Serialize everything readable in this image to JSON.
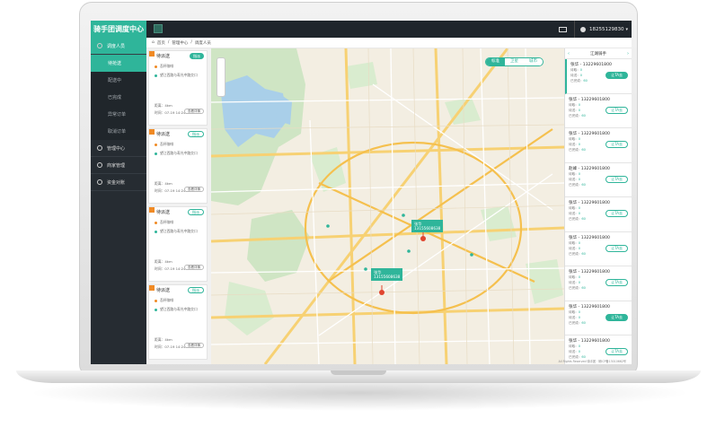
{
  "header": {
    "logo_text": "骑手团调度中心",
    "phone": "18255129830",
    "mail_icon": "mail-icon",
    "user_icon": "user-icon"
  },
  "sidebar": {
    "items": [
      {
        "label": "调度人员",
        "type": "section",
        "active": true
      },
      {
        "label": "待抢送",
        "type": "sub",
        "active": true
      },
      {
        "label": "配送中",
        "type": "sub",
        "active": false
      },
      {
        "label": "已完成",
        "type": "sub",
        "active": false
      },
      {
        "label": "异常订单",
        "type": "sub",
        "active": false
      },
      {
        "label": "取消订单",
        "type": "sub",
        "active": false
      },
      {
        "label": "管理中心",
        "type": "section",
        "active": false
      },
      {
        "label": "商家管理",
        "type": "section",
        "active": false
      },
      {
        "label": "资金对账",
        "type": "section",
        "active": false
      }
    ]
  },
  "breadcrumb": {
    "home": "首页",
    "sep": "/",
    "level1": "管理中心",
    "level2": "调度人员"
  },
  "tasks": [
    {
      "title": "待派送",
      "tag": "指派",
      "tag_style": "filled",
      "shop": "吾杯咖啡",
      "addr": "望江西路与寿光中路交口",
      "distance": "距离：4km",
      "time": "时间：07-19 14:24:46",
      "action": "查看详情"
    },
    {
      "title": "待派送",
      "tag": "指派",
      "tag_style": "outline",
      "shop": "吾杯咖啡",
      "addr": "望江西路与寿光中路交口",
      "distance": "距离：4km",
      "time": "时间：07-19 14:24:46",
      "action": "查看详情"
    },
    {
      "title": "待派送",
      "tag": "指派",
      "tag_style": "outline",
      "shop": "吾杯咖啡",
      "addr": "望江西路与寿光中路交口",
      "distance": "距离：4km",
      "time": "时间：07-19 14:24:46",
      "action": "查看详情"
    },
    {
      "title": "待派送",
      "tag": "指派",
      "tag_style": "outline",
      "shop": "吾杯咖啡",
      "addr": "望江西路与寿光中路交口",
      "distance": "距离：4km",
      "time": "时间：07-19 14:24:46",
      "action": "查看详情"
    }
  ],
  "map": {
    "tabs": [
      "标准",
      "卫星",
      "城市"
    ],
    "active_tab": "标准",
    "riders": [
      {
        "name": "张华",
        "phone": "13155608638"
      },
      {
        "name": "张华",
        "phone": "13155608638"
      }
    ],
    "footer": "All Rights Reserved 骑手团 · 皖ICP备13010662号"
  },
  "right_panel": {
    "title": "江湖骑手",
    "prev": "‹",
    "next": "›",
    "riders": [
      {
        "name": "张华 - 13229601800",
        "s1": "待取：",
        "v1": "0",
        "s2": "待送：",
        "v2": "0",
        "s3": "已完成：",
        "v3": "60",
        "btn": "让TA去",
        "selected": true,
        "btn_on": true
      },
      {
        "name": "张华 - 13229601800",
        "s1": "待取：",
        "v1": "0",
        "s2": "待送：",
        "v2": "0",
        "s3": "已完成：",
        "v3": "60",
        "btn": "让TA去",
        "selected": false,
        "btn_on": false
      },
      {
        "name": "张华 - 13229601800",
        "s1": "待取：",
        "v1": "0",
        "s2": "待送：",
        "v2": "0",
        "s3": "已完成：",
        "v3": "60",
        "btn": "让TA去",
        "selected": false,
        "btn_on": false
      },
      {
        "name": "赵峰 - 13229601800",
        "s1": "待取：",
        "v1": "0",
        "s2": "待送：",
        "v2": "0",
        "s3": "已完成：",
        "v3": "60",
        "btn": "让TA去",
        "selected": false,
        "btn_on": false
      },
      {
        "name": "张华 - 13229601800",
        "s1": "待取：",
        "v1": "0",
        "s2": "待送：",
        "v2": "0",
        "s3": "已完成：",
        "v3": "60",
        "btn": "让TA去",
        "selected": false,
        "btn_on": false
      },
      {
        "name": "张华 - 13229601800",
        "s1": "待取：",
        "v1": "0",
        "s2": "待送：",
        "v2": "0",
        "s3": "已完成：",
        "v3": "60",
        "btn": "让TA去",
        "selected": false,
        "btn_on": false
      },
      {
        "name": "张华 - 13229601800",
        "s1": "待取：",
        "v1": "0",
        "s2": "待送：",
        "v2": "0",
        "s3": "已完成：",
        "v3": "60",
        "btn": "让TA去",
        "selected": false,
        "btn_on": false
      },
      {
        "name": "张华 - 13229601800",
        "s1": "待取：",
        "v1": "0",
        "s2": "待送：",
        "v2": "0",
        "s3": "已完成：",
        "v3": "60",
        "btn": "让TA去",
        "selected": false,
        "btn_on": true
      },
      {
        "name": "张华 - 13229601800",
        "s1": "待取：",
        "v1": "0",
        "s2": "待送：",
        "v2": "0",
        "s3": "已完成：",
        "v3": "60",
        "btn": "让TA去",
        "selected": false,
        "btn_on": false
      }
    ]
  },
  "colors": {
    "accent": "#2fb59a",
    "sidebar_bg": "#262c32",
    "topbar_bg": "#1f252b",
    "tag_orange": "#f08a24"
  }
}
